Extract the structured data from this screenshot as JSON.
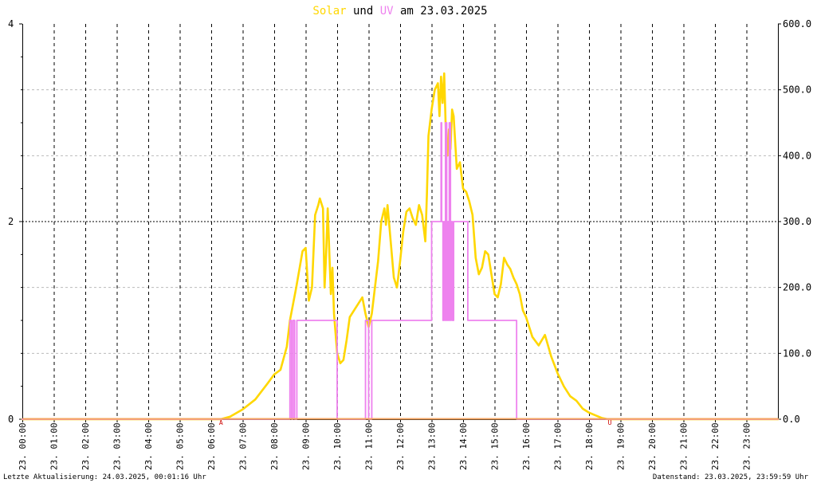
{
  "chart_data": {
    "type": "line",
    "title": {
      "parts": [
        {
          "text": "Solar",
          "color": "#ffd700"
        },
        {
          "text": " und ",
          "color": "#000000"
        },
        {
          "text": "UV",
          "color": "#ee82ee"
        },
        {
          "text": " am 23.03.2025",
          "color": "#000000"
        }
      ]
    },
    "x_axis": {
      "range_hours": [
        0,
        24
      ],
      "tick_labels": [
        "23. 00:00",
        "23. 01:00",
        "23. 02:00",
        "23. 03:00",
        "23. 04:00",
        "23. 05:00",
        "23. 06:00",
        "23. 07:00",
        "23. 08:00",
        "23. 09:00",
        "23. 10:00",
        "23. 11:00",
        "23. 12:00",
        "23. 13:00",
        "23. 14:00",
        "23. 15:00",
        "23. 16:00",
        "23. 17:00",
        "23. 18:00",
        "23. 19:00",
        "23. 20:00",
        "23. 21:00",
        "23. 22:00",
        "23. 23:00"
      ]
    },
    "y_left": {
      "range": [
        0,
        4
      ],
      "major_ticks": [
        "0",
        "2",
        "4"
      ]
    },
    "y_right": {
      "range": [
        0,
        600
      ],
      "tick_labels": [
        "0.0",
        "100.0",
        "200.0",
        "300.0",
        "400.0",
        "500.0",
        "600.0"
      ]
    },
    "grid": true,
    "series": [
      {
        "axis": "right",
        "color": "#ffd700",
        "x": [
          0,
          6.3,
          6.6,
          7.0,
          7.4,
          7.8,
          8.0,
          8.2,
          8.4,
          8.5,
          8.7,
          8.9,
          9.0,
          9.1,
          9.2,
          9.3,
          9.4,
          9.45,
          9.55,
          9.6,
          9.65,
          9.7,
          9.8,
          9.85,
          9.9,
          10.0,
          10.1,
          10.2,
          10.3,
          10.4,
          10.6,
          10.8,
          10.9,
          11.0,
          11.1,
          11.2,
          11.3,
          11.4,
          11.5,
          11.55,
          11.6,
          11.7,
          11.8,
          11.9,
          12.0,
          12.1,
          12.2,
          12.3,
          12.4,
          12.5,
          12.6,
          12.7,
          12.8,
          12.85,
          12.9,
          13.0,
          13.1,
          13.2,
          13.25,
          13.3,
          13.35,
          13.4,
          13.45,
          13.5,
          13.55,
          13.6,
          13.65,
          13.7,
          13.8,
          13.9,
          14.0,
          14.1,
          14.2,
          14.3,
          14.4,
          14.5,
          14.6,
          14.7,
          14.8,
          14.9,
          15.0,
          15.1,
          15.2,
          15.3,
          15.4,
          15.5,
          15.6,
          15.7,
          15.8,
          15.9,
          16.0,
          16.2,
          16.4,
          16.5,
          16.6,
          16.8,
          17.0,
          17.2,
          17.4,
          17.6,
          17.8,
          18.0,
          18.2,
          18.4,
          18.6,
          24
        ],
        "values": [
          0,
          0,
          4,
          15,
          30,
          55,
          68,
          75,
          110,
          150,
          200,
          255,
          260,
          180,
          200,
          310,
          325,
          335,
          320,
          200,
          250,
          320,
          190,
          230,
          160,
          100,
          85,
          90,
          120,
          155,
          170,
          185,
          160,
          140,
          160,
          200,
          240,
          300,
          320,
          295,
          325,
          270,
          215,
          200,
          240,
          285,
          315,
          320,
          305,
          295,
          325,
          310,
          270,
          340,
          430,
          470,
          500,
          510,
          460,
          520,
          480,
          525,
          440,
          400,
          440,
          410,
          470,
          460,
          380,
          390,
          350,
          345,
          330,
          310,
          245,
          220,
          230,
          255,
          250,
          220,
          190,
          185,
          205,
          245,
          235,
          228,
          215,
          205,
          190,
          165,
          155,
          125,
          112,
          120,
          128,
          95,
          70,
          50,
          35,
          28,
          16,
          10,
          6,
          2,
          0,
          0
        ]
      },
      {
        "axis": "left",
        "color": "#ee82ee",
        "x": [
          0,
          8.5,
          8.5,
          8.55,
          8.55,
          8.6,
          8.6,
          8.65,
          8.65,
          8.72,
          8.72,
          10.0,
          10.0,
          10.9,
          10.9,
          11.0,
          11.0,
          11.1,
          11.1,
          11.3,
          11.3,
          13.0,
          13.0,
          13.3,
          13.3,
          13.32,
          13.32,
          13.36,
          13.36,
          13.38,
          13.38,
          13.42,
          13.42,
          13.44,
          13.44,
          13.48,
          13.48,
          13.5,
          13.5,
          13.54,
          13.54,
          13.56,
          13.56,
          13.6,
          13.6,
          13.62,
          13.62,
          13.66,
          13.66,
          13.7,
          13.7,
          14.0,
          14.0,
          14.15,
          14.15,
          15.7,
          15.7,
          24
        ],
        "values": [
          0,
          0,
          1,
          1,
          0,
          0,
          1,
          1,
          0,
          0,
          1,
          1,
          0,
          0,
          1,
          1,
          0,
          0,
          1,
          1,
          1,
          1,
          2,
          2,
          3,
          3,
          2,
          2,
          1,
          1,
          2,
          2,
          1,
          1,
          3,
          3,
          1,
          1,
          2,
          2,
          1,
          1,
          3,
          3,
          1,
          1,
          2,
          2,
          1,
          1,
          2,
          2,
          2,
          2,
          1,
          1,
          0,
          0
        ]
      }
    ],
    "markers": [
      {
        "label": "A",
        "x_hour": 6.3,
        "color": "#cc0000"
      },
      {
        "label": "U",
        "x_hour": 18.65,
        "color": "#cc0000"
      }
    ]
  },
  "footer": {
    "left": "Letzte Aktualisierung: 24.03.2025, 00:01:16 Uhr",
    "right": "Datenstand: 23.03.2025, 23:59:59 Uhr"
  }
}
